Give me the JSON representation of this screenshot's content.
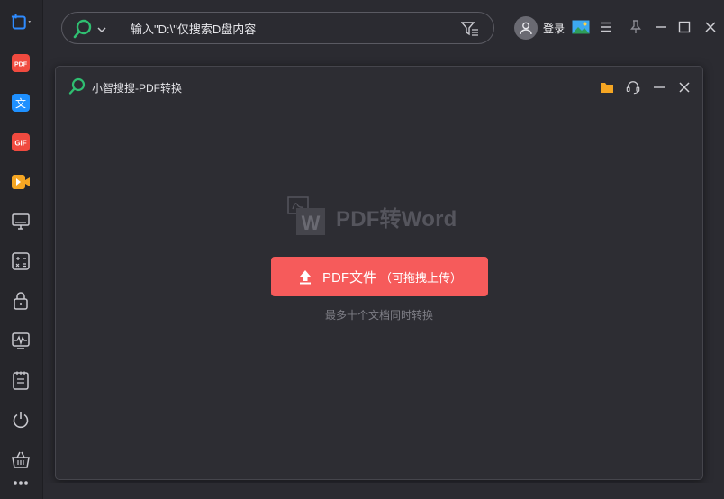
{
  "search": {
    "placeholder": "输入\"D:\\\"仅搜索D盘内容"
  },
  "header": {
    "login_label": "登录"
  },
  "panel": {
    "title": "小智搜搜-PDF转换",
    "logo_text": "PDF转Word",
    "upload_label": "PDF文件",
    "upload_sub": "（可拖拽上传）",
    "hint": "最多十个文档同时转换"
  },
  "sidebar": {
    "items": [
      {
        "icon": "crop-icon"
      },
      {
        "icon": "pdf-icon",
        "label": "PDF"
      },
      {
        "icon": "translate-icon",
        "label": "文"
      },
      {
        "icon": "gif-icon",
        "label": "GIF"
      },
      {
        "icon": "video-icon"
      },
      {
        "icon": "monitor-icon"
      },
      {
        "icon": "calculator-icon"
      },
      {
        "icon": "lock-icon"
      },
      {
        "icon": "waveform-icon"
      },
      {
        "icon": "notepad-icon"
      },
      {
        "icon": "power-icon"
      },
      {
        "icon": "basket-icon"
      },
      {
        "icon": "more-icon"
      }
    ]
  },
  "colors": {
    "accent": "#f65b5b",
    "search_green": "#2fbf71",
    "folder_orange": "#f5a623",
    "background": "#2b2b31"
  }
}
